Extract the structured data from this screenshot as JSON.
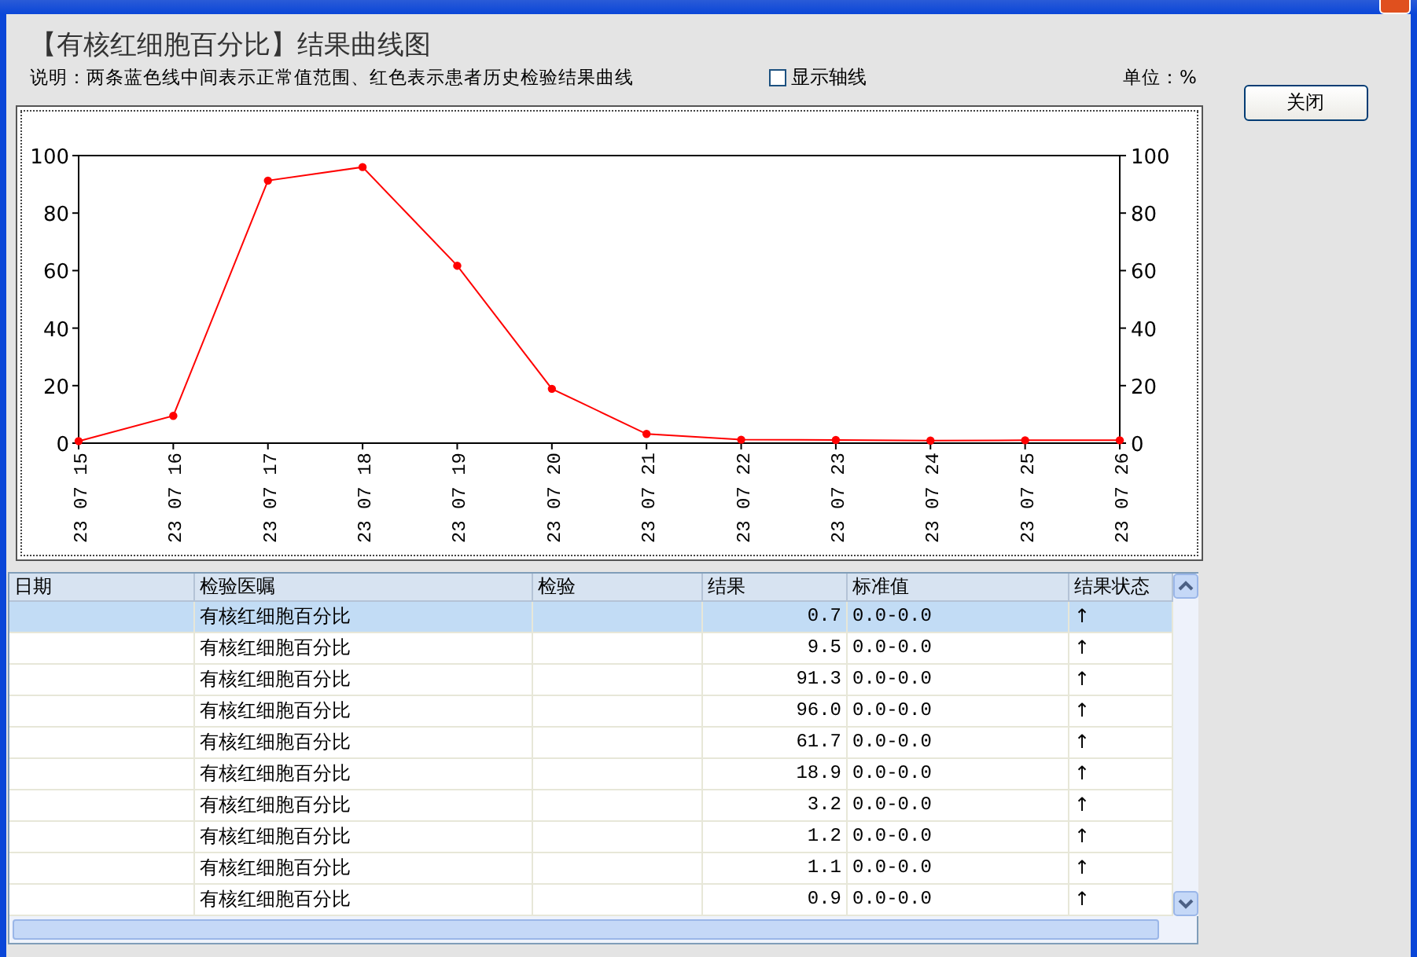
{
  "title": "【有核红细胞百分比】结果曲线图",
  "note": "说明：两条蓝色线中间表示正常值范围、红色表示患者历史检验结果曲线",
  "axis_toggle": {
    "label": "显示轴线",
    "checked": false
  },
  "unit": "单位：%",
  "close_button": "关闭",
  "chart": {
    "chart_data": {
      "type": "line",
      "categories": [
        "23 07 15",
        "23 07 16",
        "23 07 17",
        "23 07 18",
        "23 07 19",
        "23 07 20",
        "23 07 21",
        "23 07 22",
        "23 07 23",
        "23 07 24",
        "23 07 25",
        "23 07 26"
      ],
      "series": [
        {
          "color": "#ff0000",
          "marker": "circle",
          "values": [
            0.7,
            9.5,
            91.3,
            96.0,
            61.7,
            18.9,
            3.2,
            1.2,
            1.1,
            0.9,
            1.0,
            1.0
          ]
        }
      ],
      "ylim": [
        0,
        100
      ],
      "yticks": [
        0,
        20,
        40,
        60,
        80,
        100
      ]
    },
    "right_axis_ticks": [
      "100",
      "80",
      "60",
      "40",
      "20",
      "0"
    ]
  },
  "table": {
    "columns": [
      "日期",
      "检验医嘱",
      "检验",
      "结果",
      "标准值",
      "结果状态"
    ],
    "rows": [
      {
        "order": "有核红细胞百分比",
        "result": "0.7",
        "range": "0.0-0.0",
        "status": "↑",
        "selected": true
      },
      {
        "order": "有核红细胞百分比",
        "result": "9.5",
        "range": "0.0-0.0",
        "status": "↑",
        "selected": false
      },
      {
        "order": "有核红细胞百分比",
        "result": "91.3",
        "range": "0.0-0.0",
        "status": "↑",
        "selected": false
      },
      {
        "order": "有核红细胞百分比",
        "result": "96.0",
        "range": "0.0-0.0",
        "status": "↑",
        "selected": false
      },
      {
        "order": "有核红细胞百分比",
        "result": "61.7",
        "range": "0.0-0.0",
        "status": "↑",
        "selected": false
      },
      {
        "order": "有核红细胞百分比",
        "result": "18.9",
        "range": "0.0-0.0",
        "status": "↑",
        "selected": false
      },
      {
        "order": "有核红细胞百分比",
        "result": "3.2",
        "range": "0.0-0.0",
        "status": "↑",
        "selected": false
      },
      {
        "order": "有核红细胞百分比",
        "result": "1.2",
        "range": "0.0-0.0",
        "status": "↑",
        "selected": false
      },
      {
        "order": "有核红细胞百分比",
        "result": "1.1",
        "range": "0.0-0.0",
        "status": "↑",
        "selected": false
      },
      {
        "order": "有核红细胞百分比",
        "result": "0.9",
        "range": "0.0-0.0",
        "status": "↑",
        "selected": false
      }
    ]
  }
}
